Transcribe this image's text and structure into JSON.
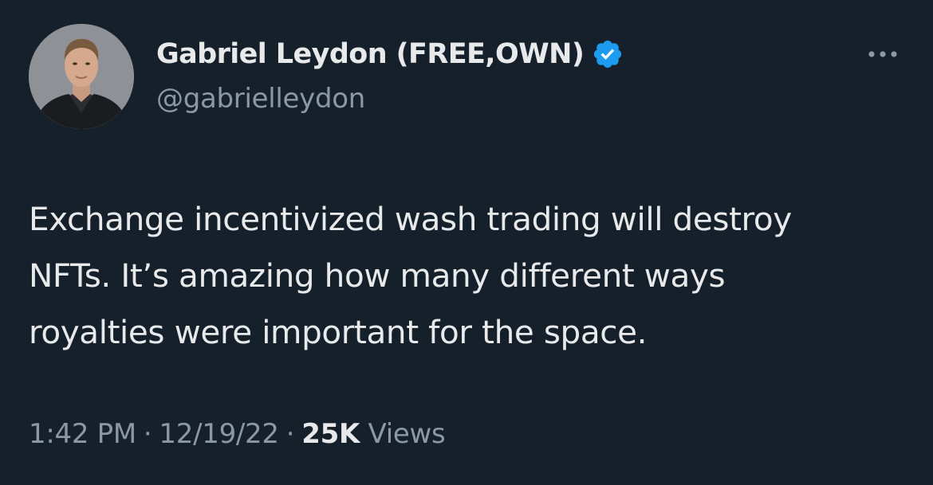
{
  "author": {
    "display_name": "Gabriel Leydon (FREE,OWN)",
    "handle": "@gabrielleydon",
    "verified": true,
    "verified_badge_color": "#1d9bf0",
    "avatar": "profile-photo"
  },
  "tweet": {
    "lines": [
      "Exchange incentivized wash trading will destroy",
      "NFTs. It’s amazing how many different ways",
      "royalties were important for the space."
    ]
  },
  "meta": {
    "time": "1:42 PM",
    "separator": "·",
    "date": "12/19/22",
    "views_count": "25K",
    "views_label": "Views"
  },
  "icons": {
    "more": "more-horizontal-icon",
    "verified": "verified-badge-icon"
  },
  "colors": {
    "background": "#15202b",
    "primary_text": "#e7e9ea",
    "secondary_text": "#8b98a5"
  }
}
